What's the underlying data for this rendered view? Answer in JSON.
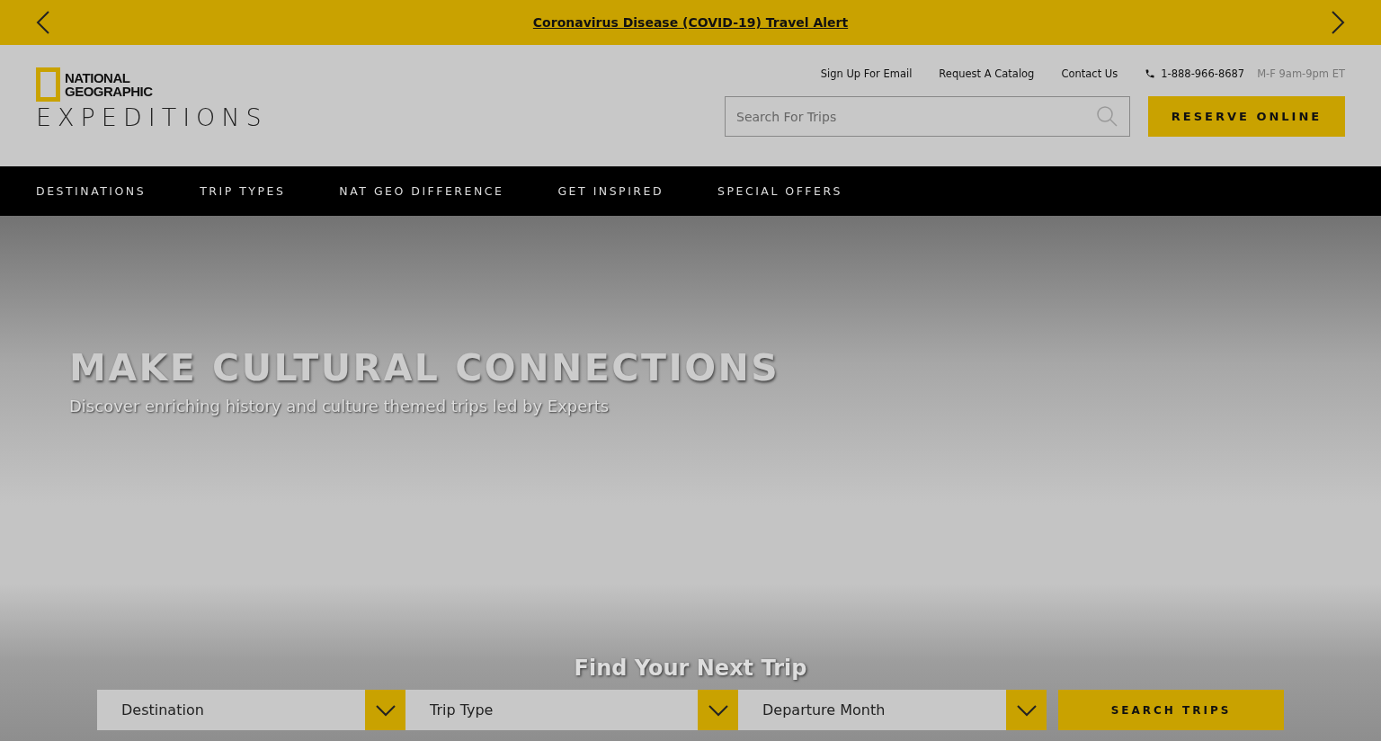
{
  "alert_bar": {
    "link": "Coronavirus Disease (COVID-19) Travel Alert"
  },
  "logo": {
    "line_1": "NATIONAL",
    "line_2": "GEOGRAPHIC",
    "wordmark": "EXPEDITIONS"
  },
  "utility_links": [
    "Sign Up For Email",
    "Request A Catalog",
    "Contact Us"
  ],
  "phone": {
    "number": "1-888-966-8687",
    "hours": "M-F 9am-9pm ET"
  },
  "search": {
    "placeholder": "Search For Trips"
  },
  "reserve_button": "RESERVE ONLINE",
  "nav": [
    "DESTINATIONS",
    "TRIP TYPES",
    "NAT GEO DIFFERENCE",
    "GET INSPIRED",
    "SPECIAL OFFERS"
  ],
  "hero": {
    "title": "MAKE CULTURAL CONNECTIONS",
    "subtitle": "Discover enriching history and culture themed trips led by Experts"
  },
  "trip_finder": {
    "heading": "Find Your Next Trip",
    "dropdowns": [
      {
        "placeholder": "Destination"
      },
      {
        "placeholder": "Trip Type"
      },
      {
        "placeholder": "Departure Month"
      }
    ],
    "button": "SEARCH TRIPS"
  }
}
